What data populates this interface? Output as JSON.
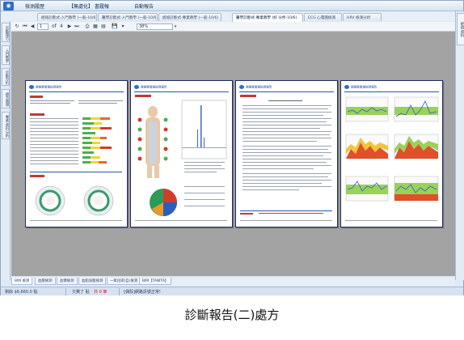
{
  "menu": {
    "items": [
      {
        "label": "檢測履歷"
      },
      {
        "label": "【無處化】 書履報"
      },
      {
        "label": "自動報告"
      }
    ]
  },
  "tabs": [
    {
      "label": "經絡診斷式-入門教學 (一般-10/6)"
    },
    {
      "label": "醫學診斷式-入門教學 (一般-10/6)"
    },
    {
      "label": "經絡診斷式-專業教學 (一般-10/6)"
    },
    {
      "label": "醫學診斷式-專業教學 (好 分析-10/6)"
    },
    {
      "label": "ECG 心電圖檢測"
    },
    {
      "label": "HRV 檢測分析"
    }
  ],
  "left_vertical_tabs": [
    {
      "label": "診斷報告"
    },
    {
      "label": "入門教學"
    },
    {
      "label": "診斷分析"
    },
    {
      "label": "處方選擇"
    },
    {
      "label": "專業 資料分析"
    }
  ],
  "right_vertical_tab": {
    "label": "經絡 資料"
  },
  "toolbar": {
    "page_current": "1",
    "page_of": "of",
    "page_total": "4",
    "zoom": "38%"
  },
  "pages": [
    {
      "header": "經絡專業儀檢測報告"
    },
    {
      "header": "經絡專業儀檢測報告"
    },
    {
      "header": "經絡專業儀檢測報告"
    },
    {
      "header": "經絡專業儀檢測報告"
    }
  ],
  "bottom_tabs": [
    {
      "label": "BMI 檢測"
    },
    {
      "label": "血壓檢測"
    },
    {
      "label": "血糖檢測"
    },
    {
      "label": "血脂尿酸檢測"
    },
    {
      "label": "一氧化碳(自)檢測"
    },
    {
      "label": "BMI【TANITA】"
    }
  ],
  "status": {
    "total": "剩餘 $6,660.0 點",
    "overdue_label": "欠費了 點",
    "overdue_value": "共 0 筆",
    "message": "[偶殼]網路訊號正常!"
  },
  "caption": "診斷報告(二)處方",
  "colors": {
    "accent": "#2a6ec7",
    "page_border": "#1f2b68",
    "viewer_bg": "#a3a3a3",
    "warn": "#d31b1b"
  }
}
